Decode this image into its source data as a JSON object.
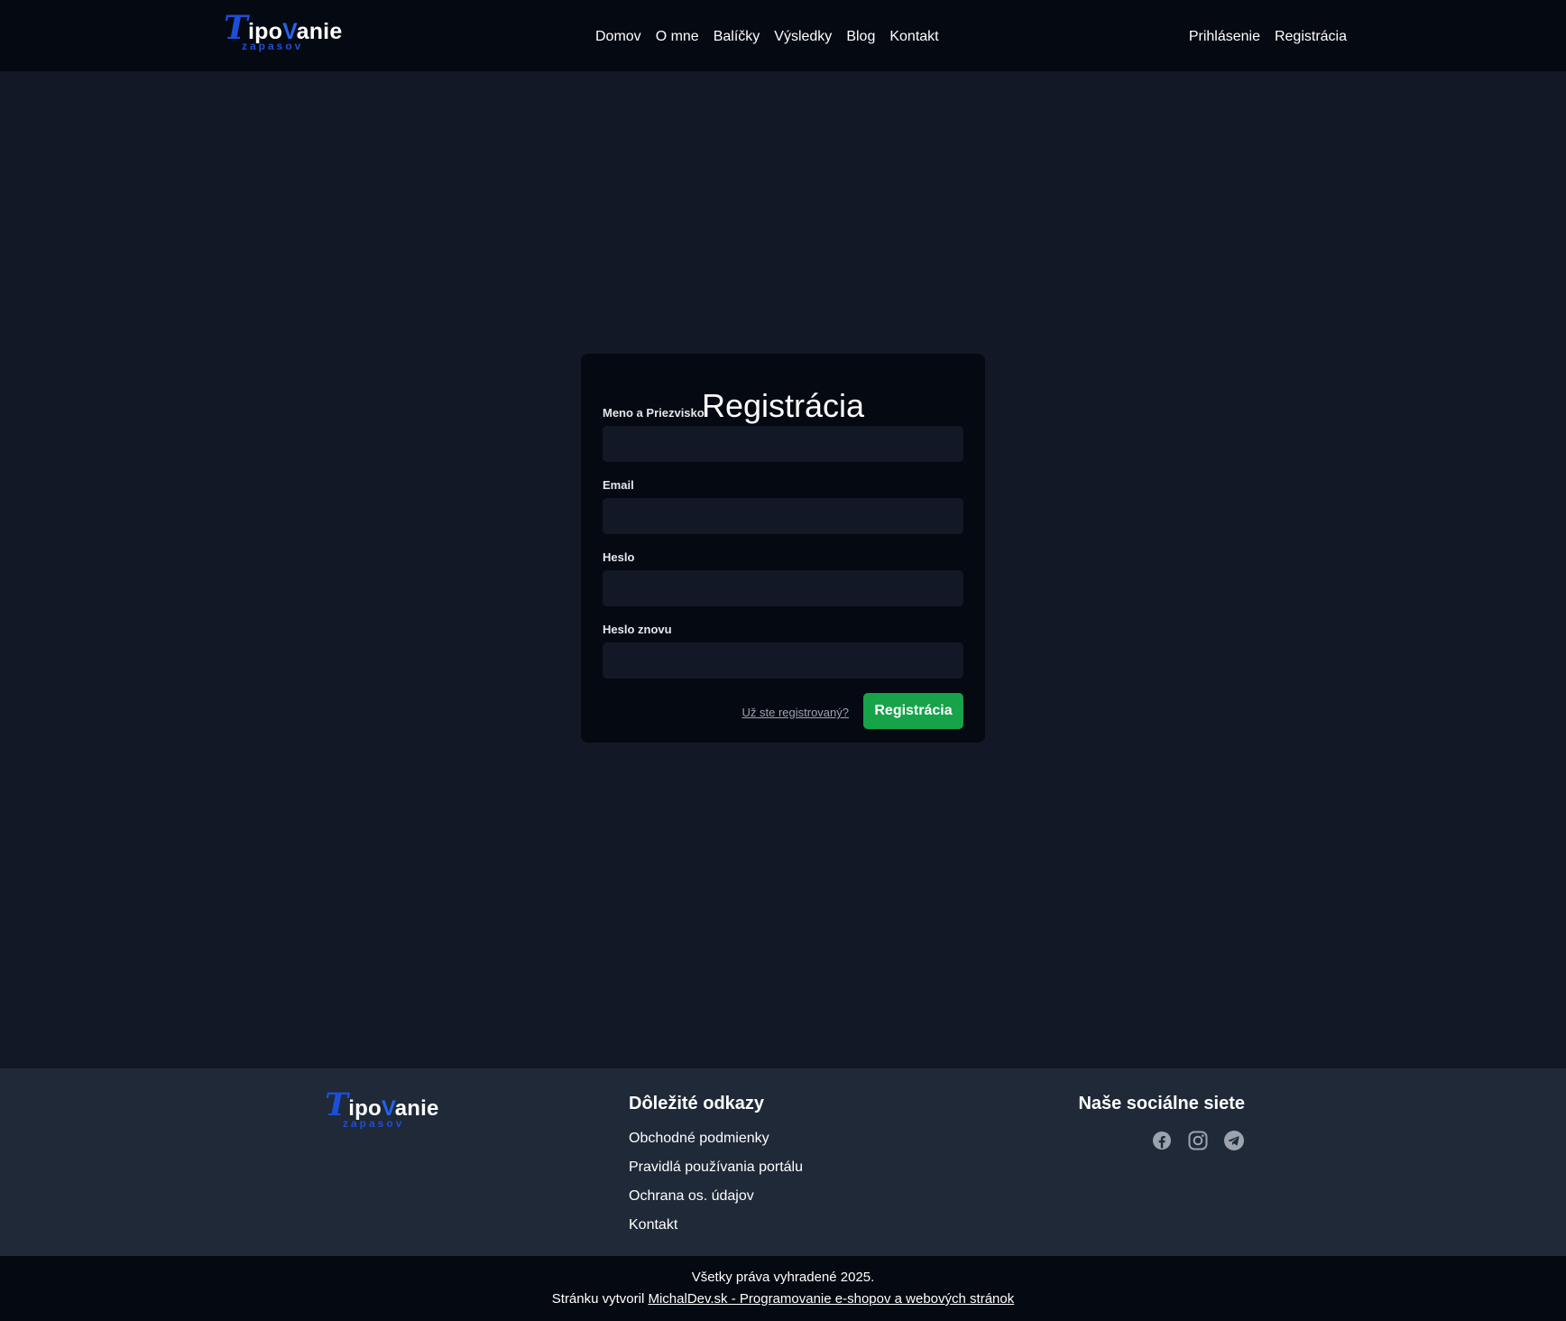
{
  "brand": {
    "logo_t": "T",
    "logo_ipo": "ipo",
    "logo_v": "V",
    "logo_anie": "anie",
    "logo_sub": "zapasov",
    "accent_color": "#1d4ed8"
  },
  "header": {
    "nav": [
      "Domov",
      "O mne",
      "Balíčky",
      "Výsledky",
      "Blog",
      "Kontakt"
    ],
    "auth": [
      "Prihlásenie",
      "Registrácia"
    ]
  },
  "form": {
    "title": "Registrácia",
    "fields": [
      {
        "label": "Meno a Priezvisko",
        "value": ""
      },
      {
        "label": "Email",
        "value": ""
      },
      {
        "label": "Heslo",
        "value": ""
      },
      {
        "label": "Heslo znovu",
        "value": ""
      }
    ],
    "login_link": "Už ste registrovaný?",
    "submit_label": "Registrácia",
    "submit_color": "#16a34a"
  },
  "footer": {
    "links_heading": "Dôležité odkazy",
    "links": [
      "Obchodné podmienky",
      "Pravidlá používania portálu",
      "Ochrana os. údajov",
      "Kontakt"
    ],
    "social_heading": "Naše sociálne siete",
    "social_icons": [
      "facebook-icon",
      "instagram-icon",
      "telegram-icon"
    ]
  },
  "bottom": {
    "copyright": "Všetky práva vyhradené 2025.",
    "credit_prefix": "Stránku vytvoril",
    "credit_link": "MichalDev.sk - Programovanie e-shopov a webových stránok"
  }
}
